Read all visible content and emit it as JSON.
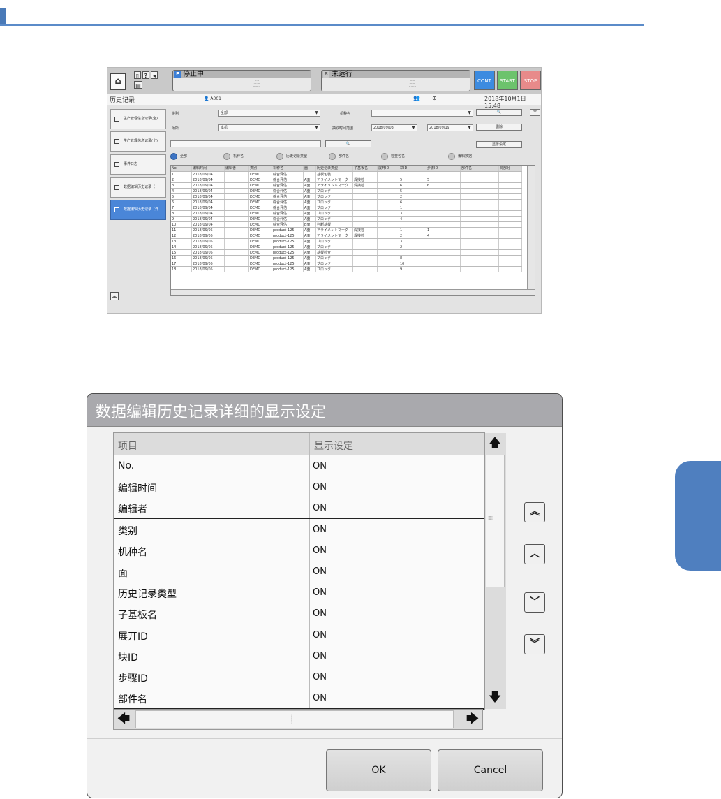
{
  "screen": {
    "status_f": {
      "icon": "F",
      "text": "停止中"
    },
    "status_r": {
      "icon": "R",
      "text": "未运行"
    },
    "buttons": {
      "cont": "CONT",
      "start": "START",
      "stop": "STOP"
    },
    "title": "历史记录",
    "user": "A001",
    "date": "2018年10月1日 15:48",
    "nav": [
      "生产管理信息记录(全)",
      "生产管理信息记录(个)",
      "事件日志",
      "数据编辑历史记录（一",
      "数据编辑历史记录（详"
    ],
    "filters": {
      "category_label": "类别",
      "category_value": "全部",
      "model_label": "机种名",
      "place_label": "场所",
      "place_value": "本机",
      "range_label": "抽取时间范围",
      "date_from": "2018/09/03",
      "date_to": "2018/09/19",
      "search_btn": "🔍",
      "delete_btn": "删除",
      "display_btn": "显示设定"
    },
    "radios": [
      "全部",
      "机种名",
      "历史记录类型",
      "部件名",
      "检查包名",
      "编辑数据"
    ],
    "table_headers": [
      "No.",
      "编辑时间",
      "编辑者",
      "类别",
      "机种名",
      "面",
      "历史记录类型",
      "子基板名",
      "展开ID",
      "块ID",
      "步骤ID",
      "部件名",
      "局部分"
    ],
    "table_rows": [
      [
        "1",
        "2018/09/04",
        "",
        "DEMO",
        "综合评估",
        "",
        "基板包装",
        "",
        "",
        "",
        "",
        "",
        ""
      ],
      [
        "2",
        "2018/09/04",
        "",
        "DEMO",
        "综合评估",
        "A面",
        "アライメントマーク",
        "焊接检",
        "",
        "5",
        "5",
        "",
        ""
      ],
      [
        "3",
        "2018/09/04",
        "",
        "DEMO",
        "综合评估",
        "A面",
        "アライメントマーク",
        "焊接检",
        "",
        "6",
        "6",
        "",
        ""
      ],
      [
        "4",
        "2018/09/04",
        "",
        "DEMO",
        "综合评估",
        "A面",
        "ブロック",
        "",
        "",
        "5",
        "",
        "",
        ""
      ],
      [
        "5",
        "2018/09/04",
        "",
        "DEMO",
        "综合评估",
        "A面",
        "ブロック",
        "",
        "",
        "2",
        "",
        "",
        ""
      ],
      [
        "6",
        "2018/09/04",
        "",
        "DEMO",
        "综合评估",
        "A面",
        "ブロック",
        "",
        "",
        "6",
        "",
        "",
        ""
      ],
      [
        "7",
        "2018/09/04",
        "",
        "DEMO",
        "综合评估",
        "A面",
        "ブロック",
        "",
        "",
        "1",
        "",
        "",
        ""
      ],
      [
        "8",
        "2018/09/04",
        "",
        "DEMO",
        "综合评估",
        "A面",
        "ブロック",
        "",
        "",
        "3",
        "",
        "",
        ""
      ],
      [
        "9",
        "2018/09/04",
        "",
        "DEMO",
        "综合评估",
        "A面",
        "ブロック",
        "",
        "",
        "4",
        "",
        "",
        ""
      ],
      [
        "10",
        "2018/09/04",
        "",
        "DEMO",
        "综合评估",
        "B面",
        "判断基板",
        "",
        "",
        "",
        "",
        "",
        ""
      ],
      [
        "11",
        "2018/09/05",
        "",
        "DEMO",
        "product-125",
        "A面",
        "アライメントマーク",
        "焊接检",
        "",
        "1",
        "1",
        "",
        ""
      ],
      [
        "12",
        "2018/09/05",
        "",
        "DEMO",
        "product-125",
        "A面",
        "アライメントマーク",
        "焊接检",
        "",
        "2",
        "4",
        "",
        ""
      ],
      [
        "13",
        "2018/09/05",
        "",
        "DEMO",
        "product-125",
        "A面",
        "ブロック",
        "",
        "",
        "3",
        "",
        "",
        ""
      ],
      [
        "14",
        "2018/09/05",
        "",
        "DEMO",
        "product-125",
        "A面",
        "ブロック",
        "",
        "",
        "2",
        "",
        "",
        ""
      ],
      [
        "15",
        "2018/09/05",
        "",
        "DEMO",
        "product-125",
        "A面",
        "基板检查",
        "",
        "",
        "",
        "",
        "",
        ""
      ],
      [
        "16",
        "2018/09/05",
        "",
        "DEMO",
        "product-125",
        "A面",
        "ブロック",
        "",
        "",
        "8",
        "",
        "",
        ""
      ],
      [
        "17",
        "2018/09/05",
        "",
        "DEMO",
        "product-125",
        "A面",
        "ブロック",
        "",
        "",
        "10",
        "",
        "",
        ""
      ],
      [
        "18",
        "2018/09/05",
        "",
        "DEMO",
        "product-125",
        "A面",
        "ブロック",
        "",
        "",
        "9",
        "",
        "",
        ""
      ]
    ]
  },
  "dialog": {
    "title": "数据编辑历史记录详细的显示设定",
    "col_item": "项目",
    "col_setting": "显示设定",
    "rows": [
      {
        "item": "No.",
        "value": "ON"
      },
      {
        "item": "编辑时间",
        "value": "ON"
      },
      {
        "item": "编辑者",
        "value": "ON"
      },
      {
        "item": "类别",
        "value": "ON"
      },
      {
        "item": "机种名",
        "value": "ON"
      },
      {
        "item": "面",
        "value": "ON"
      },
      {
        "item": "历史记录类型",
        "value": "ON"
      },
      {
        "item": "子基板名",
        "value": "ON"
      },
      {
        "item": "展开ID",
        "value": "ON"
      },
      {
        "item": "块ID",
        "value": "ON"
      },
      {
        "item": "步骤ID",
        "value": "ON"
      },
      {
        "item": "部件名",
        "value": "ON"
      }
    ],
    "ok": "OK",
    "cancel": "Cancel"
  },
  "colors": {
    "accent": "#4f7fbf",
    "cont": "#3c8be0",
    "start": "#6cc36c",
    "stop": "#e88a8a"
  }
}
